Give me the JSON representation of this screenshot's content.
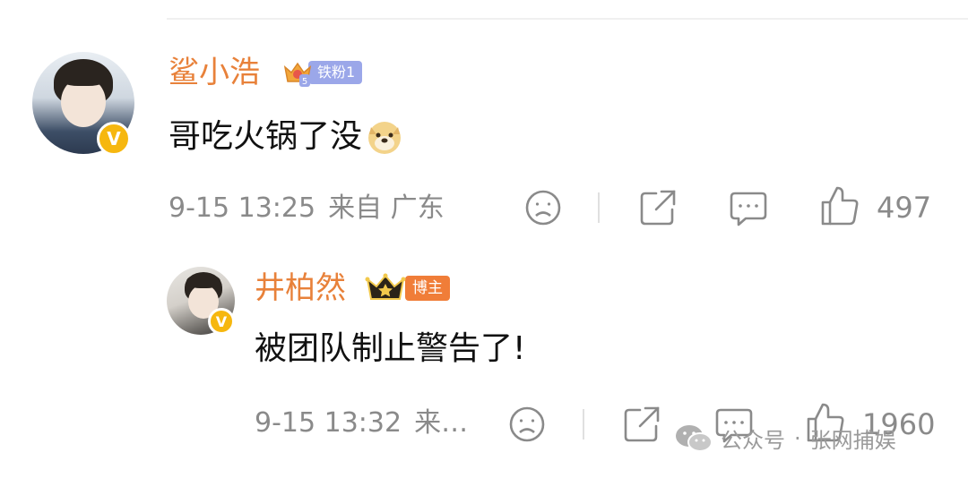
{
  "comments": [
    {
      "username": "鲨小浩",
      "badge": {
        "level_text": "5",
        "label": "铁粉1",
        "color": "#9ba7e9"
      },
      "text": "哥吃火锅了没",
      "emoji": "doge-icon",
      "meta": {
        "date": "9-15 13:25",
        "source": "来自 广东"
      },
      "like_count": "497",
      "verified": "V"
    },
    {
      "username": "井柏然",
      "badge": {
        "label": "博主",
        "color": "#f07d38"
      },
      "text": "被团队制止警告了!",
      "meta": {
        "date": "9-15 13:32",
        "source": "来…"
      },
      "like_count": "1960",
      "verified": "V"
    }
  ],
  "watermark": {
    "prefix": "公众号",
    "sep": "·",
    "name": "张网捕娱"
  },
  "colors": {
    "username": "#e8813a",
    "meta": "#8a8a8a",
    "verified": "#f6b70f"
  }
}
